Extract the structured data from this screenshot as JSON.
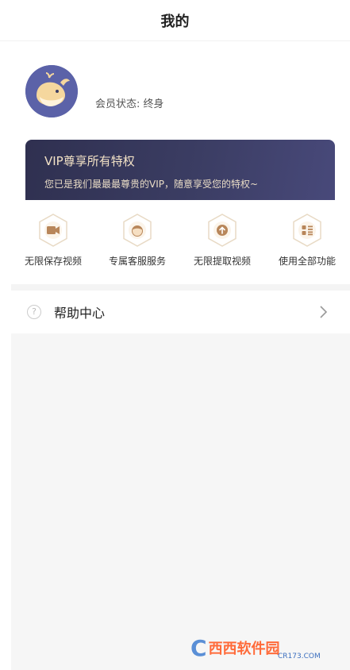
{
  "header": {
    "title": "我的"
  },
  "profile": {
    "member_status": "会员状态: 终身"
  },
  "vip_card": {
    "title": "VIP尊享所有特权",
    "description": "您已是我们最最最尊贵的VIP，随意享受您的特权~"
  },
  "features": [
    {
      "label": "无限保存视频",
      "icon": "video-camera-icon"
    },
    {
      "label": "专属客服服务",
      "icon": "customer-service-icon"
    },
    {
      "label": "无限提取视频",
      "icon": "extract-upload-icon"
    },
    {
      "label": "使用全部功能",
      "icon": "all-functions-icon"
    }
  ],
  "help": {
    "label": "帮助中心",
    "icon": "question-mark-icon"
  },
  "watermark": {
    "logo": "C",
    "brand": "西西软件园",
    "url": "CR173.COM"
  },
  "colors": {
    "accent_gold": "#c9a574",
    "vip_card_bg": "#3b3d63",
    "vip_text": "#f3e2c6",
    "avatar_bg": "#5b62a8"
  }
}
